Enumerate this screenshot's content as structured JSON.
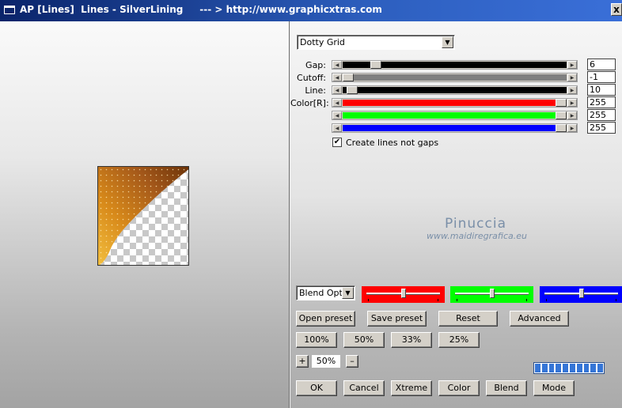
{
  "window": {
    "title": "AP [Lines]  Lines - SilverLining     --- > http://www.graphicxtras.com",
    "close_label": "x"
  },
  "preset_dropdown": {
    "value": "Dotty Grid"
  },
  "sliders": [
    {
      "id": "gap",
      "label": "Gap:",
      "value": "6",
      "fill": "#000000",
      "knob_frac": 0.13
    },
    {
      "id": "cutoff",
      "label": "Cutoff:",
      "value": "-1",
      "fill": "#808080",
      "knob_frac": 0.0
    },
    {
      "id": "line",
      "label": "Line:",
      "value": "10",
      "fill": "#000000",
      "knob_frac": 0.02
    },
    {
      "id": "red",
      "label": "Color[R]:",
      "value": "255",
      "fill": "#ff0000",
      "knob_frac": 1.0
    },
    {
      "id": "green",
      "label": "",
      "value": "255",
      "fill": "#00ff00",
      "knob_frac": 1.0
    },
    {
      "id": "blue",
      "label": "",
      "value": "255",
      "fill": "#0000ff",
      "knob_frac": 1.0
    }
  ],
  "create_lines": {
    "label": "Create lines not gaps",
    "checked": true,
    "mark": "✔"
  },
  "watermark": {
    "name": "Pinuccia",
    "url": "www.maidiregrafica.eu"
  },
  "blend_dropdown": {
    "value": "Blend Optio"
  },
  "color_sliders": [
    {
      "color": "#ff0000",
      "knob_frac": 0.5
    },
    {
      "color": "#00ff00",
      "knob_frac": 0.5
    },
    {
      "color": "#0000ff",
      "knob_frac": 0.5
    }
  ],
  "buttons": {
    "open_preset": "Open preset",
    "save_preset": "Save preset",
    "reset": "Reset",
    "advanced": "Advanced",
    "zoom_100": "100%",
    "zoom_50": "50%",
    "zoom_33": "33%",
    "zoom_25": "25%",
    "plus": "+",
    "minus": "–",
    "ok": "OK",
    "cancel": "Cancel",
    "xtreme": "Xtreme",
    "color": "Color",
    "blend": "Blend",
    "mode": "Mode"
  },
  "zoom": {
    "value": "50%"
  },
  "progress": {
    "segments": 10,
    "filled": 10
  },
  "colors": {
    "title_dark": "#0a246a",
    "title_light": "#3a6fd8",
    "gradient_gold": "#e8a020",
    "gradient_brown": "#7a3e0c"
  }
}
